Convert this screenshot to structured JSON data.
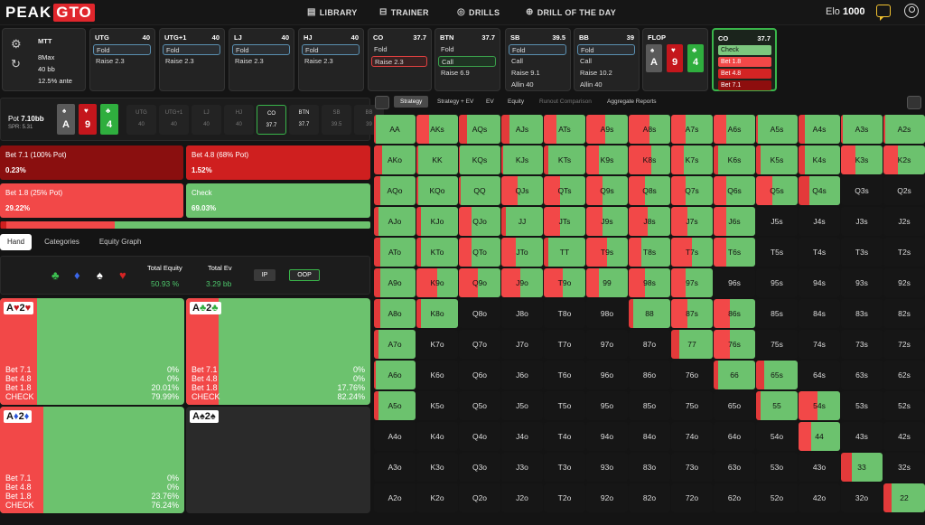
{
  "nav": {
    "logo_a": "PEAK",
    "logo_b": "GTO",
    "links": [
      {
        "label": "LIBRARY",
        "icon": "book-icon"
      },
      {
        "label": "TRAINER",
        "icon": "gamepad-icon"
      },
      {
        "label": "DRILLS",
        "icon": "target-icon"
      },
      {
        "label": "DRILL OF THE DAY",
        "icon": "plus-circle-icon"
      }
    ],
    "elo_label": "Elo",
    "elo_value": "1000"
  },
  "game": {
    "type": "MTT",
    "max": "8Max",
    "stack": "40 bb",
    "ante": "12.5% ante"
  },
  "tree": [
    {
      "pos": "UTG",
      "stack": "40",
      "actions": [
        {
          "label": "Fold",
          "sel": "gray"
        },
        {
          "label": "Raise 2.3",
          "sel": ""
        }
      ]
    },
    {
      "pos": "UTG+1",
      "stack": "40",
      "actions": [
        {
          "label": "Fold",
          "sel": "gray"
        },
        {
          "label": "Raise 2.3",
          "sel": ""
        }
      ]
    },
    {
      "pos": "LJ",
      "stack": "40",
      "actions": [
        {
          "label": "Fold",
          "sel": "gray"
        },
        {
          "label": "Raise 2.3",
          "sel": ""
        }
      ]
    },
    {
      "pos": "HJ",
      "stack": "40",
      "actions": [
        {
          "label": "Fold",
          "sel": "gray"
        },
        {
          "label": "Raise 2.3",
          "sel": ""
        }
      ]
    },
    {
      "pos": "CO",
      "stack": "37.7",
      "actions": [
        {
          "label": "Fold",
          "sel": ""
        },
        {
          "label": "Raise 2.3",
          "sel": "red"
        }
      ]
    },
    {
      "pos": "BTN",
      "stack": "37.7",
      "actions": [
        {
          "label": "Fold",
          "sel": ""
        },
        {
          "label": "Call",
          "sel": "green"
        },
        {
          "label": "Raise 6.9",
          "sel": ""
        }
      ]
    },
    {
      "pos": "SB",
      "stack": "39.5",
      "actions": [
        {
          "label": "Fold",
          "sel": "gray"
        },
        {
          "label": "Call",
          "sel": ""
        },
        {
          "label": "Raise 9.1",
          "sel": ""
        },
        {
          "label": "Allin 40",
          "sel": ""
        }
      ]
    },
    {
      "pos": "BB",
      "stack": "39",
      "actions": [
        {
          "label": "Fold",
          "sel": "gray"
        },
        {
          "label": "Call",
          "sel": ""
        },
        {
          "label": "Raise 10.2",
          "sel": ""
        },
        {
          "label": "Allin 40",
          "sel": ""
        }
      ]
    }
  ],
  "flop": {
    "label": "FLOP",
    "cards": [
      {
        "rank": "A",
        "suit": "♠",
        "color": "#5a5a5a"
      },
      {
        "rank": "9",
        "suit": "♥",
        "color": "#c4161c"
      },
      {
        "rank": "4",
        "suit": "♣",
        "color": "#2fae3e"
      }
    ]
  },
  "active": {
    "pos": "CO",
    "stack": "37.7",
    "options": [
      {
        "label": "Check",
        "color": "#7cc77e",
        "text": "#111"
      },
      {
        "label": "Bet 1.8",
        "color": "#f24848",
        "text": "#fff"
      },
      {
        "label": "Bet 4.8",
        "color": "#d42424",
        "text": "#fff"
      },
      {
        "label": "Bet 7.1",
        "color": "#8e0e0e",
        "text": "#fff"
      }
    ]
  },
  "pot": {
    "label": "Pot",
    "value": "7.10bb",
    "spr": "SPR: 5.31"
  },
  "seats": [
    {
      "name": "UTG",
      "value": "40",
      "state": "off"
    },
    {
      "name": "UTG+1",
      "value": "40",
      "state": "off"
    },
    {
      "name": "LJ",
      "value": "40",
      "state": "off"
    },
    {
      "name": "HJ",
      "value": "40",
      "state": "off"
    },
    {
      "name": "CO",
      "value": "37.7",
      "state": "hero"
    },
    {
      "name": "BTN",
      "value": "37.7",
      "state": "on"
    },
    {
      "name": "SB",
      "value": "39.5",
      "state": "off"
    },
    {
      "name": "BB",
      "value": "39",
      "state": "off"
    }
  ],
  "strategy": [
    {
      "label": "Bet 7.1 (100% Pot)",
      "pct": "0.23%",
      "color": "#8a0f0f",
      "frac": 0.0023
    },
    {
      "label": "Bet 4.8 (68% Pot)",
      "pct": "1.52%",
      "color": "#cf1f1f",
      "frac": 0.0152
    },
    {
      "label": "Bet 1.8 (25% Pot)",
      "pct": "29.22%",
      "color": "#f24848",
      "frac": 0.2922
    },
    {
      "label": "Check",
      "pct": "69.03%",
      "color": "#6cc26e",
      "frac": 0.6903
    }
  ],
  "subtabs": [
    "Hand",
    "Categories",
    "Equity Graph"
  ],
  "equity": {
    "total_equity_label": "Total Equity",
    "total_equity": "50.93 %",
    "total_ev_label": "Total Ev",
    "total_ev": "3.29 bb",
    "ip": "IP",
    "oop": "OOP"
  },
  "suit_filters": [
    {
      "glyph": "♣",
      "color": "#3cbf50"
    },
    {
      "glyph": "♦",
      "color": "#3a66e8"
    },
    {
      "glyph": "♠",
      "color": "#ffffff"
    },
    {
      "glyph": "♥",
      "color": "#d42424"
    }
  ],
  "combos": [
    {
      "rank1": "A",
      "suit1": "♥",
      "c1": "#c4161c",
      "rank2": "2",
      "suit2": "♥",
      "c2": "#c4161c",
      "bet_frac": 0.2001,
      "rows": [
        {
          "l": "Bet 7.1",
          "v": "0%"
        },
        {
          "l": "Bet 4.8",
          "v": "0%"
        },
        {
          "l": "Bet 1.8",
          "v": "20.01%"
        },
        {
          "l": "CHECK",
          "v": "79.99%"
        }
      ]
    },
    {
      "rank1": "A",
      "suit1": "♣",
      "c1": "#2fae3e",
      "rank2": "2",
      "suit2": "♣",
      "c2": "#2fae3e",
      "bet_frac": 0.1776,
      "rows": [
        {
          "l": "Bet 7.1",
          "v": "0%"
        },
        {
          "l": "Bet 4.8",
          "v": "0%"
        },
        {
          "l": "Bet 1.8",
          "v": "17.76%"
        },
        {
          "l": "CHECK",
          "v": "82.24%"
        }
      ]
    },
    {
      "rank1": "A",
      "suit1": "♦",
      "c1": "#2a55d8",
      "rank2": "2",
      "suit2": "♦",
      "c2": "#2a55d8",
      "bet_frac": 0.2376,
      "rows": [
        {
          "l": "Bet 7.1",
          "v": "0%"
        },
        {
          "l": "Bet 4.8",
          "v": "0%"
        },
        {
          "l": "Bet 1.8",
          "v": "23.76%"
        },
        {
          "l": "CHECK",
          "v": "76.24%"
        }
      ]
    },
    {
      "rank1": "A",
      "suit1": "♠",
      "c1": "#222222",
      "rank2": "2",
      "suit2": "♠",
      "c2": "#222222",
      "bet_frac": null,
      "rows": []
    }
  ],
  "matrix_tabs": [
    "Strategy",
    "Strategy + EV",
    "EV",
    "Equity",
    "Runout Comparison",
    "Aggregate Reports"
  ],
  "ranks": [
    "A",
    "K",
    "Q",
    "J",
    "T",
    "9",
    "8",
    "7",
    "6",
    "5",
    "4",
    "3",
    "2"
  ],
  "matrix_bet_fracs": [
    [
      0.05,
      0.3,
      0.2,
      0.2,
      0.3,
      0.45,
      0.5,
      0.35,
      0.3,
      0.05,
      0.15,
      0.05,
      0.05
    ],
    [
      0.2,
      0.05,
      0.02,
      0.05,
      0.1,
      0.3,
      0.55,
      0.3,
      0.1,
      0.1,
      0.15,
      0.35,
      0.35
    ],
    [
      0.15,
      0.05,
      0.05,
      0.4,
      0.4,
      0.4,
      0.4,
      0.35,
      0.3,
      0.4,
      0.25,
      null,
      null
    ],
    [
      0.1,
      0.1,
      0.3,
      0.1,
      0.4,
      0.4,
      0.45,
      0.4,
      0.3,
      null,
      null,
      null,
      null
    ],
    [
      0.15,
      0.1,
      0.3,
      0.35,
      0.1,
      0.5,
      0.3,
      0.5,
      0.3,
      null,
      null,
      null,
      null
    ],
    [
      0.15,
      0.5,
      0.45,
      0.45,
      0.45,
      0.3,
      0.4,
      0.35,
      null,
      null,
      null,
      null,
      null
    ],
    [
      0.15,
      0.1,
      null,
      null,
      null,
      null,
      0.1,
      0.4,
      0.4,
      null,
      null,
      null,
      null
    ],
    [
      0.1,
      null,
      null,
      null,
      null,
      null,
      null,
      0.2,
      0.4,
      null,
      null,
      null,
      null
    ],
    [
      0.05,
      null,
      null,
      null,
      null,
      null,
      null,
      null,
      0.1,
      0.2,
      null,
      null,
      null
    ],
    [
      0.1,
      null,
      null,
      null,
      null,
      null,
      null,
      null,
      null,
      0.1,
      0.45,
      null,
      null
    ],
    [
      null,
      null,
      null,
      null,
      null,
      null,
      null,
      null,
      null,
      null,
      0.3,
      null,
      null
    ],
    [
      null,
      null,
      null,
      null,
      null,
      null,
      null,
      null,
      null,
      null,
      null,
      0.25,
      null
    ],
    [
      null,
      null,
      null,
      null,
      null,
      null,
      null,
      null,
      null,
      null,
      null,
      null,
      0.2
    ]
  ]
}
